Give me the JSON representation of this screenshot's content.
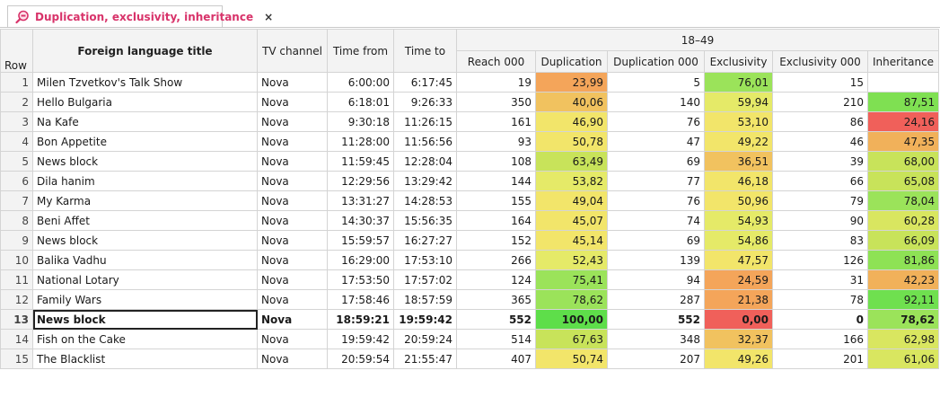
{
  "tab": {
    "title": "Duplication, exclusivity, inheritance",
    "close": "×"
  },
  "header": {
    "row": "Row",
    "title": "Foreign language title",
    "channel": "TV channel",
    "time_from": "Time from",
    "time_to": "Time to",
    "group": "18–49",
    "reach": "Reach 000",
    "duplication": "Duplication",
    "duplication_000": "Duplication 000",
    "exclusivity": "Exclusivity",
    "exclusivity_000": "Exclusivity 000",
    "inheritance": "Inheritance"
  },
  "colors": {
    "red": "#f0605a",
    "orange": "#f4a55a",
    "light_orange": "#f1c25f",
    "yellow": "#f2e56a",
    "yellow_green": "#c8e35a",
    "light_green": "#9be35a",
    "green": "#6fe04f"
  },
  "rows": [
    {
      "row": "1",
      "title": "Milen Tzvetkov's Talk Show",
      "channel": "Nova",
      "from": "6:00:00",
      "to": "6:17:45",
      "reach": "19",
      "dup": "23,99",
      "dup_c": "#f4a55a",
      "dup000": "5",
      "exc": "76,01",
      "exc_c": "#9be35a",
      "exc000": "15",
      "inh": "",
      "inh_c": ""
    },
    {
      "row": "2",
      "title": "Hello Bulgaria",
      "channel": "Nova",
      "from": "6:18:01",
      "to": "9:26:33",
      "reach": "350",
      "dup": "40,06",
      "dup_c": "#f1c25f",
      "dup000": "140",
      "exc": "59,94",
      "exc_c": "#e5ea68",
      "exc000": "210",
      "inh": "87,51",
      "inh_c": "#7fe052"
    },
    {
      "row": "3",
      "title": "Na Kafe",
      "channel": "Nova",
      "from": "9:30:18",
      "to": "11:26:15",
      "reach": "161",
      "dup": "46,90",
      "dup_c": "#f2e56a",
      "dup000": "76",
      "exc": "53,10",
      "exc_c": "#f2e56a",
      "exc000": "86",
      "inh": "24,16",
      "inh_c": "#f0605a"
    },
    {
      "row": "4",
      "title": "Bon Appetite",
      "channel": "Nova",
      "from": "11:28:00",
      "to": "11:56:56",
      "reach": "93",
      "dup": "50,78",
      "dup_c": "#f2e56a",
      "dup000": "47",
      "exc": "49,22",
      "exc_c": "#f2e56a",
      "exc000": "46",
      "inh": "47,35",
      "inh_c": "#f1b15a"
    },
    {
      "row": "5",
      "title": "News block",
      "channel": "Nova",
      "from": "11:59:45",
      "to": "12:28:04",
      "reach": "108",
      "dup": "63,49",
      "dup_c": "#c8e35a",
      "dup000": "69",
      "exc": "36,51",
      "exc_c": "#f1c25f",
      "exc000": "39",
      "inh": "68,00",
      "inh_c": "#c8e35a"
    },
    {
      "row": "6",
      "title": "Dila hanim",
      "channel": "Nova",
      "from": "12:29:56",
      "to": "13:29:42",
      "reach": "144",
      "dup": "53,82",
      "dup_c": "#e5ea68",
      "dup000": "77",
      "exc": "46,18",
      "exc_c": "#f2e56a",
      "exc000": "66",
      "inh": "65,08",
      "inh_c": "#c8e35a"
    },
    {
      "row": "7",
      "title": "My Karma",
      "channel": "Nova",
      "from": "13:31:27",
      "to": "14:28:53",
      "reach": "155",
      "dup": "49,04",
      "dup_c": "#f2e56a",
      "dup000": "76",
      "exc": "50,96",
      "exc_c": "#f2e56a",
      "exc000": "79",
      "inh": "78,04",
      "inh_c": "#9be35a"
    },
    {
      "row": "8",
      "title": "Beni Affet",
      "channel": "Nova",
      "from": "14:30:37",
      "to": "15:56:35",
      "reach": "164",
      "dup": "45,07",
      "dup_c": "#f2e56a",
      "dup000": "74",
      "exc": "54,93",
      "exc_c": "#e5ea68",
      "exc000": "90",
      "inh": "60,28",
      "inh_c": "#d9e660"
    },
    {
      "row": "9",
      "title": "News block",
      "channel": "Nova",
      "from": "15:59:57",
      "to": "16:27:27",
      "reach": "152",
      "dup": "45,14",
      "dup_c": "#f2e56a",
      "dup000": "69",
      "exc": "54,86",
      "exc_c": "#e5ea68",
      "exc000": "83",
      "inh": "66,09",
      "inh_c": "#c8e35a"
    },
    {
      "row": "10",
      "title": "Balika Vadhu",
      "channel": "Nova",
      "from": "16:29:00",
      "to": "17:53:10",
      "reach": "266",
      "dup": "52,43",
      "dup_c": "#e5ea68",
      "dup000": "139",
      "exc": "47,57",
      "exc_c": "#f2e56a",
      "exc000": "126",
      "inh": "81,86",
      "inh_c": "#8ee255"
    },
    {
      "row": "11",
      "title": "National Lotary",
      "channel": "Nova",
      "from": "17:53:50",
      "to": "17:57:02",
      "reach": "124",
      "dup": "75,41",
      "dup_c": "#9be35a",
      "dup000": "94",
      "exc": "24,59",
      "exc_c": "#f4a55a",
      "exc000": "31",
      "inh": "42,23",
      "inh_c": "#f1b15a"
    },
    {
      "row": "12",
      "title": "Family Wars",
      "channel": "Nova",
      "from": "17:58:46",
      "to": "18:57:59",
      "reach": "365",
      "dup": "78,62",
      "dup_c": "#9be35a",
      "dup000": "287",
      "exc": "21,38",
      "exc_c": "#f4a55a",
      "exc000": "78",
      "inh": "92,11",
      "inh_c": "#6fe04f"
    },
    {
      "row": "13",
      "title": "News block",
      "channel": "Nova",
      "from": "18:59:21",
      "to": "19:59:42",
      "reach": "552",
      "dup": "100,00",
      "dup_c": "#5ede4a",
      "dup000": "552",
      "exc": "0,00",
      "exc_c": "#f0605a",
      "exc000": "0",
      "inh": "78,62",
      "inh_c": "#9be35a"
    },
    {
      "row": "14",
      "title": "Fish on the Cake",
      "channel": "Nova",
      "from": "19:59:42",
      "to": "20:59:24",
      "reach": "514",
      "dup": "67,63",
      "dup_c": "#c8e35a",
      "dup000": "348",
      "exc": "32,37",
      "exc_c": "#f1c25f",
      "exc000": "166",
      "inh": "62,98",
      "inh_c": "#d9e660"
    },
    {
      "row": "15",
      "title": "The Blacklist",
      "channel": "Nova",
      "from": "20:59:54",
      "to": "21:55:47",
      "reach": "407",
      "dup": "50,74",
      "dup_c": "#f2e56a",
      "dup000": "207",
      "exc": "49,26",
      "exc_c": "#f2e56a",
      "exc000": "201",
      "inh": "61,06",
      "inh_c": "#d9e660"
    }
  ],
  "selected_row": 12
}
